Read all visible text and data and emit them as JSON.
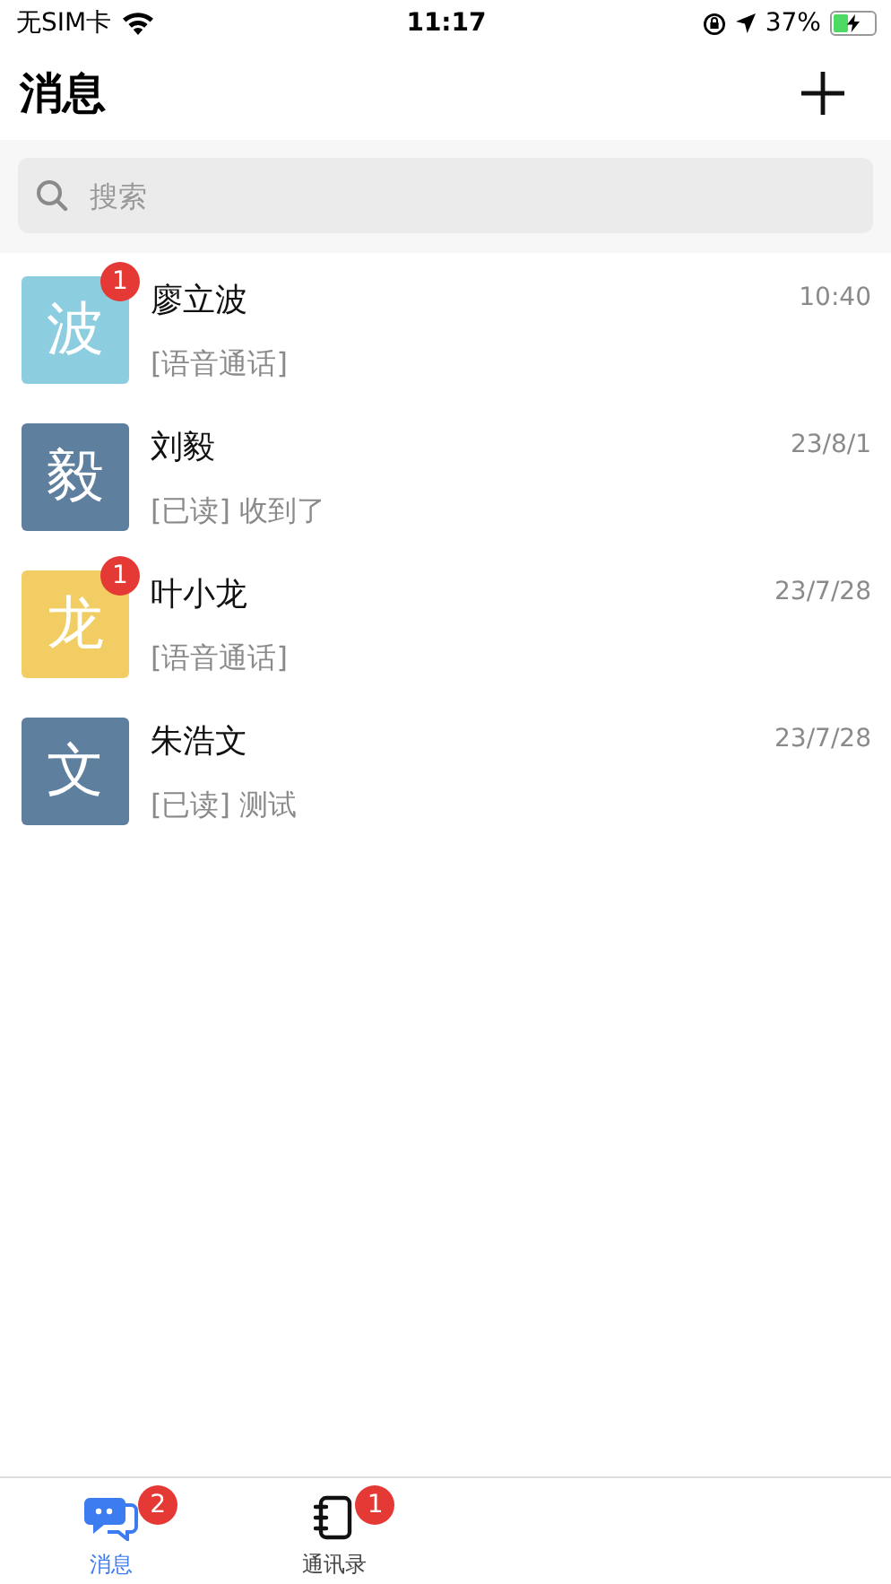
{
  "status_bar": {
    "carrier": "无SIM卡",
    "time": "11:17",
    "battery": "37%"
  },
  "header": {
    "title": "消息"
  },
  "search": {
    "placeholder": "搜索"
  },
  "conversations": [
    {
      "avatar": "波",
      "color": "#8ccde0",
      "name": "廖立波",
      "preview": "[语音通话]",
      "time": "10:40",
      "badge": "1"
    },
    {
      "avatar": "毅",
      "color": "#5f7f9f",
      "name": "刘毅",
      "preview": "[已读] 收到了",
      "time": "23/8/1"
    },
    {
      "avatar": "龙",
      "color": "#f2cd63",
      "name": "叶小龙",
      "preview": "[语音通话]",
      "time": "23/7/28",
      "badge": "1"
    },
    {
      "avatar": "文",
      "color": "#5f7f9f",
      "name": "朱浩文",
      "preview": "[已读] 测试",
      "time": "23/7/28"
    }
  ],
  "tab_bar": [
    {
      "label": "消息",
      "kind": "messages",
      "selected": true,
      "badge": "2"
    },
    {
      "label": "通讯录",
      "kind": "contacts",
      "selected": false,
      "badge": "1"
    }
  ]
}
